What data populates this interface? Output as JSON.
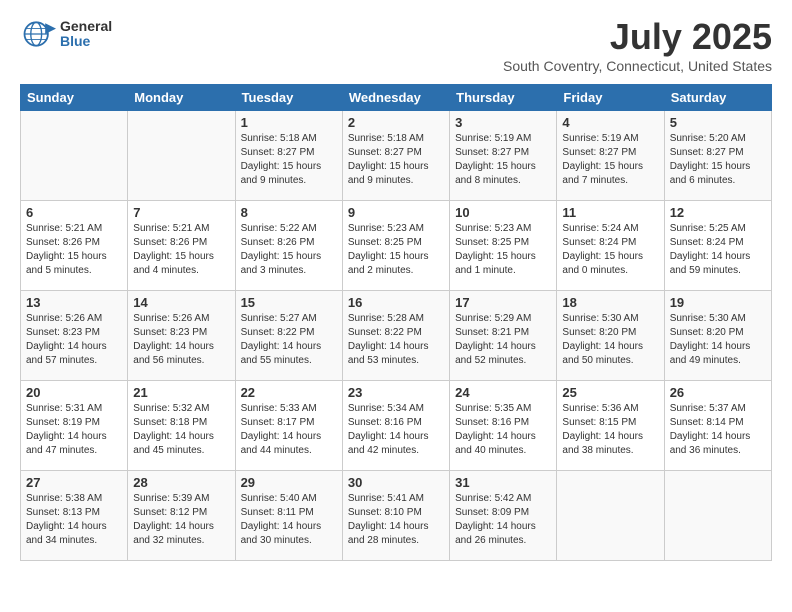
{
  "header": {
    "logo": {
      "general": "General",
      "blue": "Blue"
    },
    "title": "July 2025",
    "location": "South Coventry, Connecticut, United States"
  },
  "weekdays": [
    "Sunday",
    "Monday",
    "Tuesday",
    "Wednesday",
    "Thursday",
    "Friday",
    "Saturday"
  ],
  "weeks": [
    [
      {
        "day": "",
        "info": ""
      },
      {
        "day": "",
        "info": ""
      },
      {
        "day": "1",
        "info": "Sunrise: 5:18 AM\nSunset: 8:27 PM\nDaylight: 15 hours\nand 9 minutes."
      },
      {
        "day": "2",
        "info": "Sunrise: 5:18 AM\nSunset: 8:27 PM\nDaylight: 15 hours\nand 9 minutes."
      },
      {
        "day": "3",
        "info": "Sunrise: 5:19 AM\nSunset: 8:27 PM\nDaylight: 15 hours\nand 8 minutes."
      },
      {
        "day": "4",
        "info": "Sunrise: 5:19 AM\nSunset: 8:27 PM\nDaylight: 15 hours\nand 7 minutes."
      },
      {
        "day": "5",
        "info": "Sunrise: 5:20 AM\nSunset: 8:27 PM\nDaylight: 15 hours\nand 6 minutes."
      }
    ],
    [
      {
        "day": "6",
        "info": "Sunrise: 5:21 AM\nSunset: 8:26 PM\nDaylight: 15 hours\nand 5 minutes."
      },
      {
        "day": "7",
        "info": "Sunrise: 5:21 AM\nSunset: 8:26 PM\nDaylight: 15 hours\nand 4 minutes."
      },
      {
        "day": "8",
        "info": "Sunrise: 5:22 AM\nSunset: 8:26 PM\nDaylight: 15 hours\nand 3 minutes."
      },
      {
        "day": "9",
        "info": "Sunrise: 5:23 AM\nSunset: 8:25 PM\nDaylight: 15 hours\nand 2 minutes."
      },
      {
        "day": "10",
        "info": "Sunrise: 5:23 AM\nSunset: 8:25 PM\nDaylight: 15 hours\nand 1 minute."
      },
      {
        "day": "11",
        "info": "Sunrise: 5:24 AM\nSunset: 8:24 PM\nDaylight: 15 hours\nand 0 minutes."
      },
      {
        "day": "12",
        "info": "Sunrise: 5:25 AM\nSunset: 8:24 PM\nDaylight: 14 hours\nand 59 minutes."
      }
    ],
    [
      {
        "day": "13",
        "info": "Sunrise: 5:26 AM\nSunset: 8:23 PM\nDaylight: 14 hours\nand 57 minutes."
      },
      {
        "day": "14",
        "info": "Sunrise: 5:26 AM\nSunset: 8:23 PM\nDaylight: 14 hours\nand 56 minutes."
      },
      {
        "day": "15",
        "info": "Sunrise: 5:27 AM\nSunset: 8:22 PM\nDaylight: 14 hours\nand 55 minutes."
      },
      {
        "day": "16",
        "info": "Sunrise: 5:28 AM\nSunset: 8:22 PM\nDaylight: 14 hours\nand 53 minutes."
      },
      {
        "day": "17",
        "info": "Sunrise: 5:29 AM\nSunset: 8:21 PM\nDaylight: 14 hours\nand 52 minutes."
      },
      {
        "day": "18",
        "info": "Sunrise: 5:30 AM\nSunset: 8:20 PM\nDaylight: 14 hours\nand 50 minutes."
      },
      {
        "day": "19",
        "info": "Sunrise: 5:30 AM\nSunset: 8:20 PM\nDaylight: 14 hours\nand 49 minutes."
      }
    ],
    [
      {
        "day": "20",
        "info": "Sunrise: 5:31 AM\nSunset: 8:19 PM\nDaylight: 14 hours\nand 47 minutes."
      },
      {
        "day": "21",
        "info": "Sunrise: 5:32 AM\nSunset: 8:18 PM\nDaylight: 14 hours\nand 45 minutes."
      },
      {
        "day": "22",
        "info": "Sunrise: 5:33 AM\nSunset: 8:17 PM\nDaylight: 14 hours\nand 44 minutes."
      },
      {
        "day": "23",
        "info": "Sunrise: 5:34 AM\nSunset: 8:16 PM\nDaylight: 14 hours\nand 42 minutes."
      },
      {
        "day": "24",
        "info": "Sunrise: 5:35 AM\nSunset: 8:16 PM\nDaylight: 14 hours\nand 40 minutes."
      },
      {
        "day": "25",
        "info": "Sunrise: 5:36 AM\nSunset: 8:15 PM\nDaylight: 14 hours\nand 38 minutes."
      },
      {
        "day": "26",
        "info": "Sunrise: 5:37 AM\nSunset: 8:14 PM\nDaylight: 14 hours\nand 36 minutes."
      }
    ],
    [
      {
        "day": "27",
        "info": "Sunrise: 5:38 AM\nSunset: 8:13 PM\nDaylight: 14 hours\nand 34 minutes."
      },
      {
        "day": "28",
        "info": "Sunrise: 5:39 AM\nSunset: 8:12 PM\nDaylight: 14 hours\nand 32 minutes."
      },
      {
        "day": "29",
        "info": "Sunrise: 5:40 AM\nSunset: 8:11 PM\nDaylight: 14 hours\nand 30 minutes."
      },
      {
        "day": "30",
        "info": "Sunrise: 5:41 AM\nSunset: 8:10 PM\nDaylight: 14 hours\nand 28 minutes."
      },
      {
        "day": "31",
        "info": "Sunrise: 5:42 AM\nSunset: 8:09 PM\nDaylight: 14 hours\nand 26 minutes."
      },
      {
        "day": "",
        "info": ""
      },
      {
        "day": "",
        "info": ""
      }
    ]
  ]
}
